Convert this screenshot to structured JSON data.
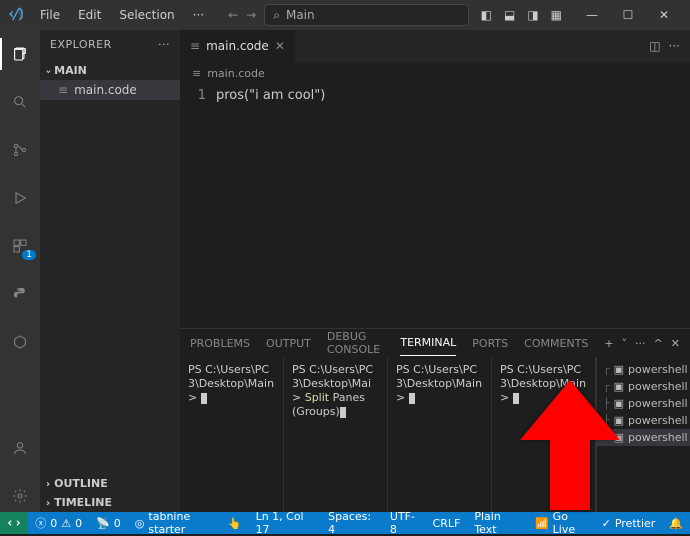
{
  "titlebar": {
    "menu": [
      "File",
      "Edit",
      "Selection",
      "···"
    ],
    "search_placeholder": "Main"
  },
  "sidebar": {
    "title": "EXPLORER",
    "section": "MAIN",
    "files": [
      {
        "name": "main.code"
      }
    ],
    "outline": "OUTLINE",
    "timeline": "TIMELINE"
  },
  "editor": {
    "tab": "main.code",
    "breadcrumb": "main.code",
    "line_number": "1",
    "code_line": "pros(\"i am cool\")"
  },
  "panel": {
    "tabs": [
      "PROBLEMS",
      "OUTPUT",
      "DEBUG CONSOLE",
      "TERMINAL",
      "PORTS",
      "COMMENTS"
    ],
    "active_tab": "TERMINAL",
    "terminals": [
      {
        "prompt": "PS C:\\Users\\PC3\\Desktop\\Main> ",
        "body": ""
      },
      {
        "prompt": "PS C:\\Users\\PC3\\Desktop\\Mai> ",
        "body_yellow": "Split",
        "body_rest": " Panes (Groups)"
      },
      {
        "prompt": "PS C:\\Users\\PC3\\Desktop\\Main> ",
        "body": ""
      },
      {
        "prompt": "PS C:\\Users\\PC3\\Desktop\\Main> ",
        "body": ""
      }
    ],
    "term_list": [
      {
        "tree": "┌",
        "name": "powershell"
      },
      {
        "tree": "┌",
        "name": "powershell"
      },
      {
        "tree": "├",
        "name": "powershell"
      },
      {
        "tree": "├",
        "name": "powershell"
      },
      {
        "tree": "└",
        "name": "powershell"
      }
    ]
  },
  "statusbar": {
    "errors": "0",
    "warnings": "0",
    "ports": "0",
    "tabnine": "tabnine starter",
    "ln_col": "Ln 1, Col 17",
    "spaces": "Spaces: 4",
    "encoding": "UTF-8",
    "eol": "CRLF",
    "lang": "Plain Text",
    "golive": "Go Live",
    "prettier": "Prettier"
  }
}
